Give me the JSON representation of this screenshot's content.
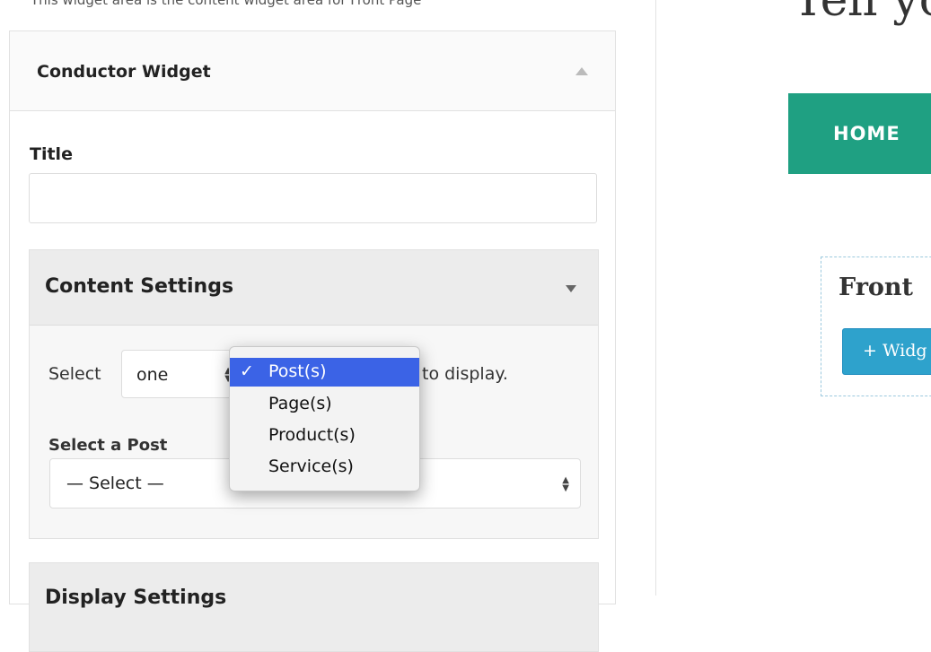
{
  "left_panel": {
    "area_description": "This widget area is the content widget area for Front Page",
    "widget": {
      "title": "Conductor Widget",
      "title_field_label": "Title",
      "title_field_value": "",
      "content_settings": {
        "heading": "Content Settings",
        "select_prefix": "Select",
        "count_value": "one",
        "select_suffix": "to display.",
        "post_label": "Select a Post",
        "post_value": "— Select —"
      },
      "display_settings": {
        "heading": "Display Settings"
      }
    }
  },
  "dropdown": {
    "options": [
      "Post(s)",
      "Page(s)",
      "Product(s)",
      "Service(s)"
    ],
    "selected_index": 0,
    "check_glyph": "✓"
  },
  "preview": {
    "site_title": "Tell yo",
    "nav": {
      "home_label": "HOME"
    },
    "widget_area": {
      "heading": "Front",
      "add_widget_label": "+ Widg"
    }
  },
  "colors": {
    "nav_bg": "#1fa082",
    "button_bg": "#2ea2cc",
    "dropdown_highlight": "#3b63e6"
  }
}
